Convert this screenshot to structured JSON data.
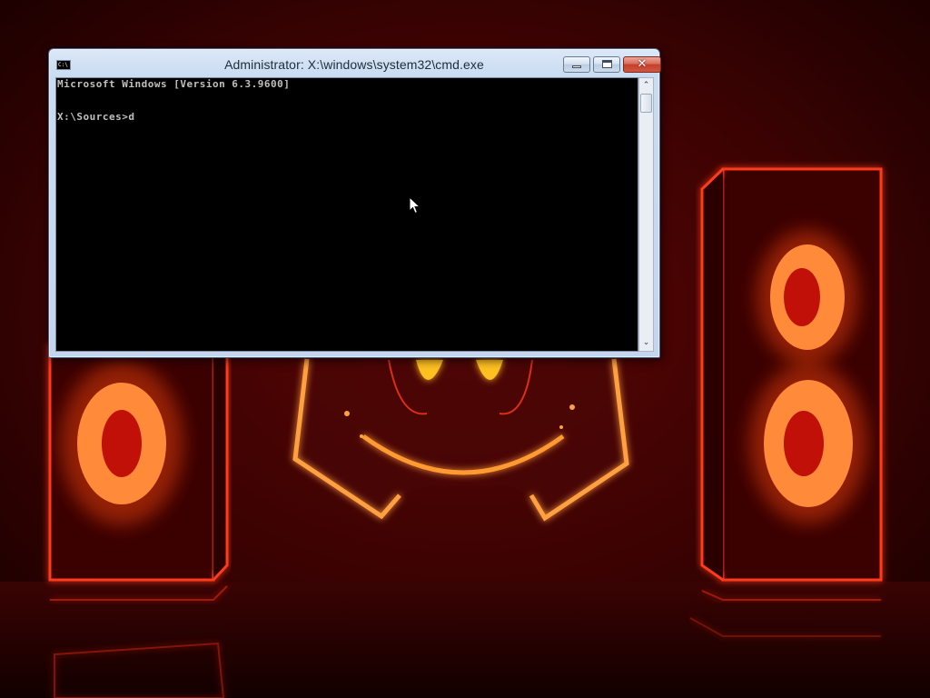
{
  "window": {
    "title": "Administrator: X:\\windows\\system32\\cmd.exe",
    "icon_text": "C:\\",
    "close_glyph": "✕"
  },
  "console": {
    "lines": [
      "Microsoft Windows [Version 6.3.9600]",
      "X:\\Sources>d"
    ],
    "background": "#000000",
    "text_color": "#c0c0c0"
  },
  "scrollbar": {
    "up_glyph": "⌃",
    "down_glyph": "⌄"
  },
  "icons": {
    "app": "cmd-icon",
    "minimize": "minimize-icon",
    "maximize": "maximize-icon",
    "close": "close-icon",
    "cursor": "mouse-pointer-icon"
  },
  "colors": {
    "wallpaper_base": "#2a0000",
    "neon_red": "#ff2a10",
    "neon_orange": "#ffa040",
    "close_button": "#c8432f"
  }
}
